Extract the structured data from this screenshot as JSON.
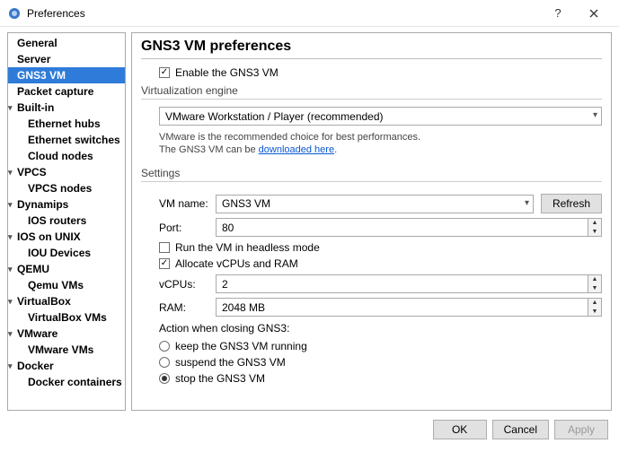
{
  "window": {
    "title": "Preferences"
  },
  "sidebar": {
    "items": [
      {
        "label": "General"
      },
      {
        "label": "Server"
      },
      {
        "label": "GNS3 VM"
      },
      {
        "label": "Packet capture"
      },
      {
        "label": "Built-in"
      },
      {
        "label": "Ethernet hubs"
      },
      {
        "label": "Ethernet switches"
      },
      {
        "label": "Cloud nodes"
      },
      {
        "label": "VPCS"
      },
      {
        "label": "VPCS nodes"
      },
      {
        "label": "Dynamips"
      },
      {
        "label": "IOS routers"
      },
      {
        "label": "IOS on UNIX"
      },
      {
        "label": "IOU Devices"
      },
      {
        "label": "QEMU"
      },
      {
        "label": "Qemu VMs"
      },
      {
        "label": "VirtualBox"
      },
      {
        "label": "VirtualBox VMs"
      },
      {
        "label": "VMware"
      },
      {
        "label": "VMware VMs"
      },
      {
        "label": "Docker"
      },
      {
        "label": "Docker containers"
      }
    ]
  },
  "page_title": "GNS3 VM preferences",
  "enable_label": "Enable the GNS3 VM",
  "virt": {
    "group_label": "Virtualization engine",
    "selected": "VMware Workstation / Player (recommended)",
    "help1": "VMware is the recommended choice for best performances.",
    "help2_prefix": "The GNS3 VM can be ",
    "help2_link": "downloaded here",
    "help2_suffix": "."
  },
  "settings": {
    "group_label": "Settings",
    "vmname_label": "VM name:",
    "vmname_value": "GNS3 VM",
    "refresh": "Refresh",
    "port_label": "Port:",
    "port_value": "80",
    "headless_label": "Run the VM in headless mode",
    "allocate_label": "Allocate vCPUs and RAM",
    "vcpus_label": "vCPUs:",
    "vcpus_value": "2",
    "ram_label": "RAM:",
    "ram_value": "2048 MB",
    "close_label": "Action when closing GNS3:",
    "radio_keep": "keep the GNS3 VM running",
    "radio_suspend": "suspend the GNS3 VM",
    "radio_stop": "stop the GNS3 VM"
  },
  "footer": {
    "ok": "OK",
    "cancel": "Cancel",
    "apply": "Apply"
  }
}
